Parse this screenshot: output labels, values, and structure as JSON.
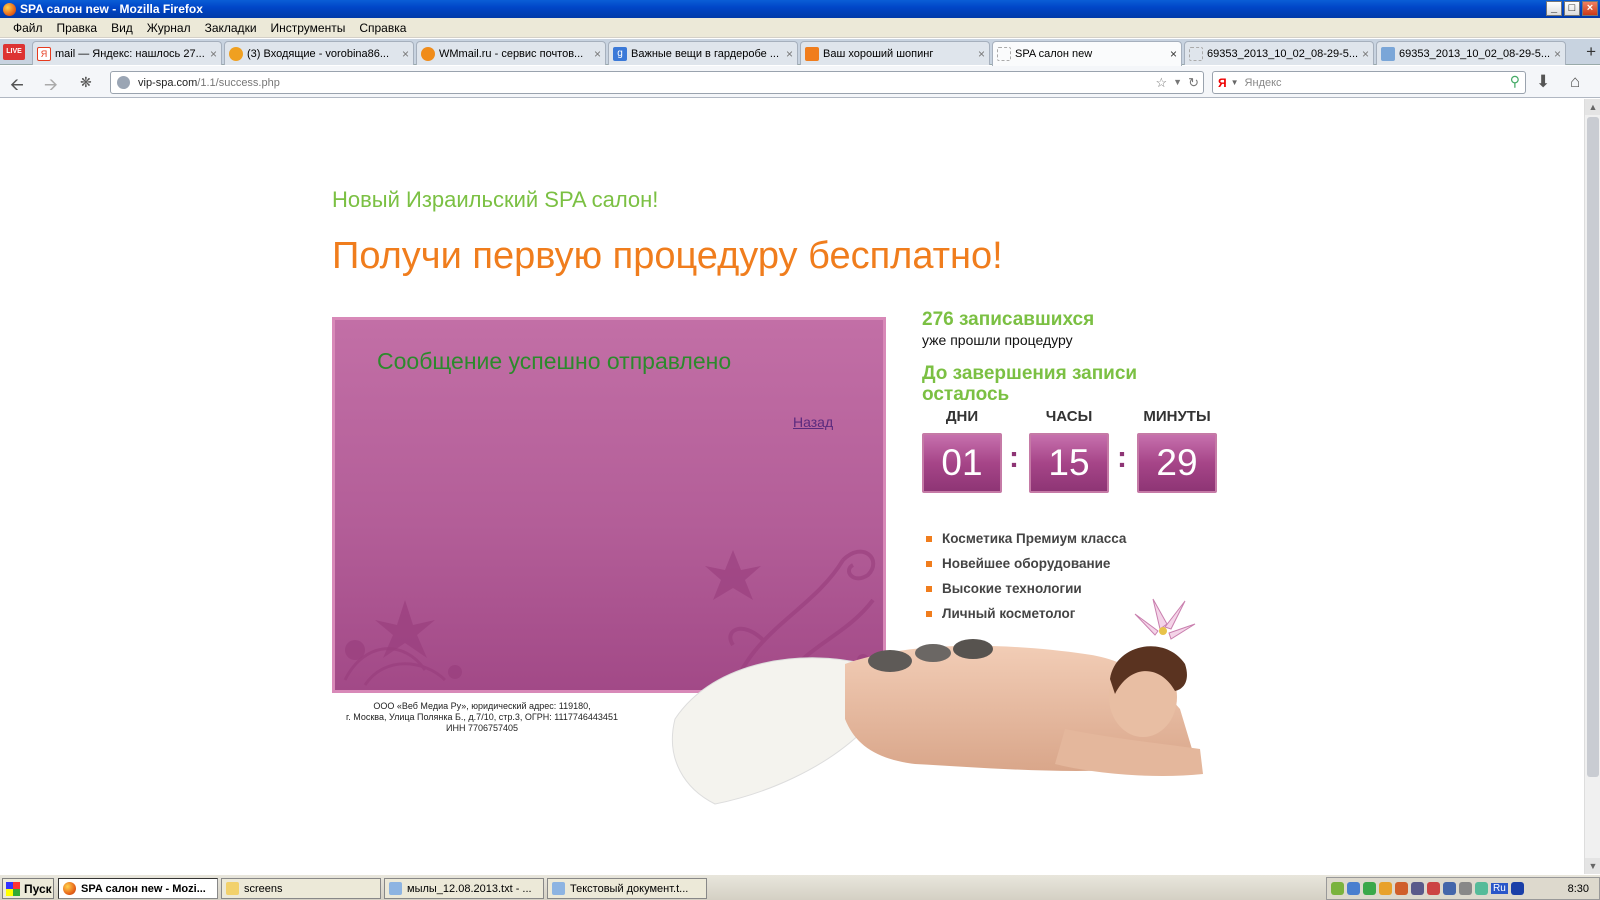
{
  "window": {
    "title": "SPA салон new - Mozilla Firefox"
  },
  "menu": [
    "Файл",
    "Правка",
    "Вид",
    "Журнал",
    "Закладки",
    "Инструменты",
    "Справка"
  ],
  "pinned_tab": {
    "label": "LIVE"
  },
  "tabs": [
    {
      "label": "mail — Яндекс: нашлось 27...",
      "icon_color": "#e63a1e"
    },
    {
      "label": "(3) Входящие - vorobina86...",
      "icon_color": "#f0a020"
    },
    {
      "label": "WMmail.ru - сервис почтов...",
      "icon_color": "#f08c1a"
    },
    {
      "label": "Важные вещи в гардеробе ...",
      "icon_color": "#3b79d8"
    },
    {
      "label": "Ваш хороший шопинг",
      "icon_color": "#f07d1d"
    },
    {
      "label": "SPA салон new",
      "icon_color": "#ffffff"
    },
    {
      "label": "69353_2013_10_02_08-29-5...",
      "icon_color": "#ffffff"
    },
    {
      "label": "69353_2013_10_02_08-29-5...",
      "icon_color": "#7aa6d8"
    }
  ],
  "address": {
    "domain": "vip-spa.com",
    "path": "/1.1/success.php"
  },
  "search": {
    "engine": "Я",
    "placeholder": "Яндекс"
  },
  "page": {
    "lead": "Новый Израильский SPA салон!",
    "headline": "Получи первую процедуру бесплатно!",
    "message": "Сообщение успешно отправлено",
    "back_link": "Назад",
    "legal": [
      "ООО «Веб Медиа Ру», юридический адрес: 119180,",
      "г. Москва, Улица Полянка Б., д.7/10, стр.3, ОГРН: 1117746443451",
      "ИНН 7706757405"
    ],
    "signed_count": "276 записавшихся",
    "signed_text": "уже прошли процедуру",
    "deadline": "До завершения записи осталось",
    "countdown": {
      "labels": [
        "ДНИ",
        "ЧАСЫ",
        "МИНУТЫ"
      ],
      "days": "01",
      "hours": "15",
      "minutes": "29"
    },
    "features": [
      "Косметика Премиум класса",
      "Новейшее оборудование",
      "Высокие технологии",
      "Личный косметолог"
    ],
    "colors": {
      "green": "#7bc043",
      "orange": "#f07d1d",
      "pink": "#b35e98"
    }
  },
  "taskbar": {
    "start": "Пуск",
    "tasks": [
      {
        "label": "SPA салон new - Mozi...",
        "active": true
      },
      {
        "label": "screens",
        "active": false
      },
      {
        "label": "мылы_12.08.2013.txt - ...",
        "active": false
      },
      {
        "label": "Текстовый документ.t...",
        "active": false
      }
    ],
    "lang": "Ru",
    "clock": "8:30"
  }
}
